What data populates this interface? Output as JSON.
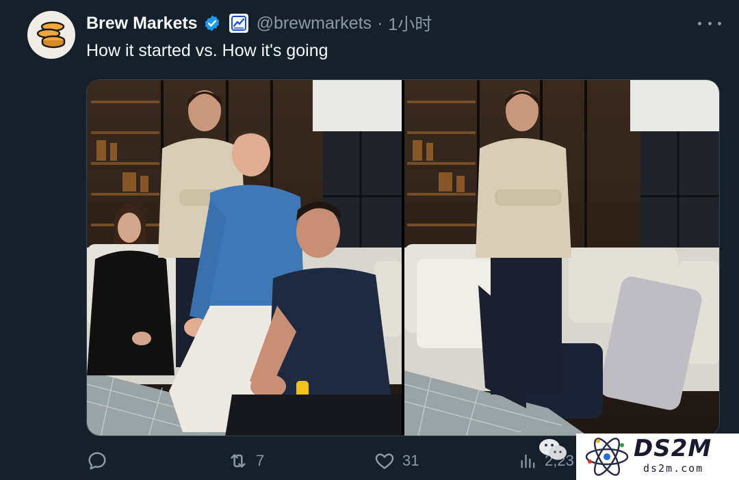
{
  "tweet": {
    "author_name": "Brew Markets",
    "handle": "@brewmarkets",
    "separator": "·",
    "time": "1小时",
    "text": "How it started vs. How it's going"
  },
  "icons": {
    "avatar": "coin-stack-logo",
    "verified": "verified-badge-icon",
    "affiliate": "chart-affiliate-icon",
    "more": "more-dots-icon",
    "reply": "reply-icon",
    "retweet": "retweet-icon",
    "like": "like-icon",
    "views": "views-icon"
  },
  "media": {
    "left_photo": "group-photo-four-people",
    "right_photo": "photo-one-person-standing"
  },
  "actions": {
    "reply_count": "",
    "retweet_count": "7",
    "like_count": "31",
    "view_count": "2,23"
  },
  "watermark": {
    "title": "DS2M",
    "url": "ds2m.com"
  },
  "colors": {
    "background": "#15202b",
    "text": "#e7e9ea",
    "muted": "#8b98a5",
    "verified": "#1d9bf0"
  }
}
